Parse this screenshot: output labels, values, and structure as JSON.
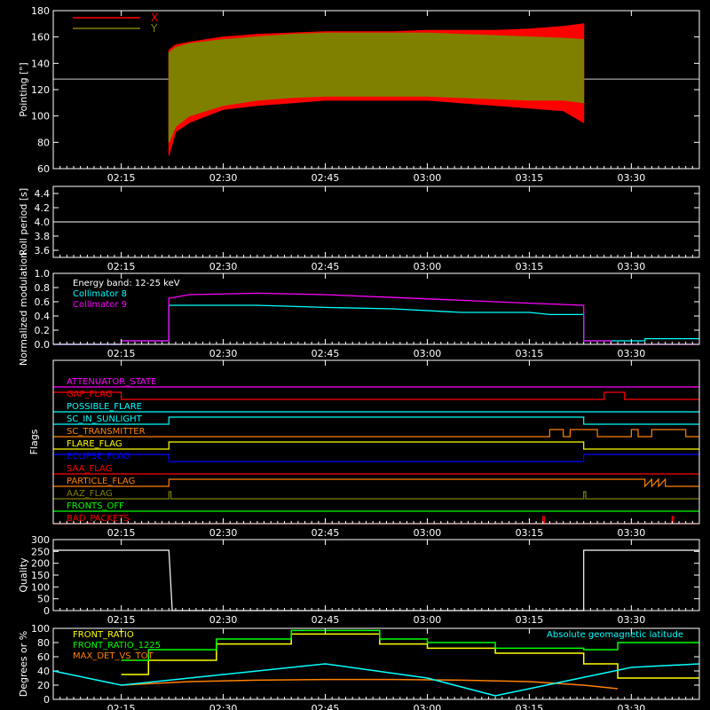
{
  "chart_data": [
    {
      "type": "line",
      "panel": "pointing",
      "ylabel": "Pointing [\"]",
      "ylim": [
        60,
        180
      ],
      "yticks": [
        60,
        80,
        100,
        120,
        140,
        160,
        180
      ],
      "xlim_minutes": [
        0,
        95
      ],
      "xticks": [
        "02:15",
        "02:30",
        "02:45",
        "03:00",
        "03:15",
        "03:30"
      ],
      "xtick_minutes": [
        10,
        25,
        40,
        55,
        70,
        85
      ],
      "reference_line": 128,
      "legend": [
        "X",
        "Y"
      ],
      "series": [
        {
          "name": "X",
          "color": "#ff0000",
          "envelope_minutes": [
            17,
            18,
            20,
            25,
            30,
            35,
            40,
            45,
            50,
            55,
            60,
            65,
            70,
            75,
            78
          ],
          "envelope_upper": [
            150,
            154,
            156,
            160,
            162,
            163,
            164,
            164,
            164,
            165,
            165,
            165,
            166,
            168,
            170
          ],
          "envelope_lower": [
            70,
            88,
            95,
            105,
            108,
            110,
            112,
            112,
            112,
            112,
            110,
            108,
            106,
            104,
            95
          ]
        },
        {
          "name": "Y",
          "color": "#808000",
          "envelope_minutes": [
            17,
            18,
            20,
            25,
            30,
            35,
            40,
            45,
            50,
            55,
            60,
            65,
            70,
            75,
            78
          ],
          "envelope_upper": [
            148,
            152,
            155,
            158,
            160,
            162,
            163,
            163,
            163,
            163,
            162,
            161,
            160,
            159,
            158
          ],
          "envelope_lower": [
            80,
            92,
            100,
            108,
            112,
            114,
            115,
            115,
            115,
            115,
            114,
            113,
            112,
            112,
            110
          ]
        }
      ]
    },
    {
      "type": "line",
      "panel": "roll",
      "ylabel": "Roll period [s]",
      "ylim": [
        3.5,
        4.5
      ],
      "yticks": [
        3.6,
        3.8,
        4.0,
        4.2,
        4.4
      ],
      "xticks": [
        "02:15",
        "02:30",
        "02:45",
        "03:00",
        "03:15",
        "03:30"
      ],
      "series": [
        {
          "name": "",
          "color": "#ffffff",
          "x": [
            0,
            95
          ],
          "values": [
            4.0,
            4.0
          ]
        }
      ]
    },
    {
      "type": "line",
      "panel": "modulation",
      "ylabel": "Normalized modulation",
      "ylim": [
        0,
        1.0
      ],
      "yticks": [
        0.0,
        0.2,
        0.4,
        0.6,
        0.8,
        1.0
      ],
      "xticks": [
        "02:15",
        "02:30",
        "02:45",
        "03:00",
        "03:15",
        "03:30"
      ],
      "annotation": "Energy band: 12-25 keV",
      "series": [
        {
          "name": "Collimator 8",
          "color": "#00ffff",
          "x": [
            0,
            10,
            10,
            17,
            17,
            20,
            30,
            40,
            50,
            60,
            70,
            73,
            73,
            78,
            78,
            87,
            87,
            95
          ],
          "values": [
            0,
            0,
            0.05,
            0.05,
            0.55,
            0.55,
            0.55,
            0.52,
            0.5,
            0.45,
            0.45,
            0.42,
            0.42,
            0.42,
            0.05,
            0.05,
            0.08,
            0.08
          ]
        },
        {
          "name": "Collimator 9",
          "color": "#ff00ff",
          "x": [
            0,
            10,
            10,
            17,
            17,
            20,
            30,
            40,
            50,
            60,
            70,
            78,
            78,
            82,
            82,
            95
          ],
          "values": [
            0,
            0,
            0.05,
            0.05,
            0.65,
            0.7,
            0.72,
            0.7,
            0.66,
            0.62,
            0.58,
            0.55,
            0.05,
            0.05,
            0,
            0
          ]
        }
      ]
    },
    {
      "type": "line",
      "panel": "flags",
      "ylabel": "Flags",
      "xticks": [
        "02:15",
        "02:30",
        "02:45",
        "03:00",
        "03:15",
        "03:30"
      ],
      "series": [
        {
          "name": "ATTENUATOR_STATE",
          "color": "#ff00ff",
          "x": [
            0,
            95
          ],
          "values": [
            0,
            0
          ]
        },
        {
          "name": "GAP_FLAG",
          "color": "#ff0000",
          "x": [
            0,
            10,
            10,
            81,
            81,
            84,
            84,
            95
          ],
          "values": [
            1,
            1,
            0,
            0,
            1,
            1,
            0,
            0
          ]
        },
        {
          "name": "POSSIBLE_FLARE",
          "color": "#00ffff",
          "x": [
            0,
            95
          ],
          "values": [
            0,
            0
          ]
        },
        {
          "name": "SC_IN_SUNLIGHT",
          "color": "#00ffff",
          "x": [
            0,
            17,
            17,
            78,
            78,
            95
          ],
          "values": [
            0,
            0,
            1,
            1,
            0,
            0
          ]
        },
        {
          "name": "SC_TRANSMITTER",
          "color": "#ff8000",
          "x": [
            0,
            73,
            73,
            75,
            75,
            76,
            76,
            80,
            80,
            85,
            85,
            86,
            86,
            88,
            88,
            93,
            93,
            95
          ],
          "values": [
            0,
            0,
            1,
            1,
            0,
            0,
            1,
            1,
            0,
            0,
            1,
            1,
            0,
            0,
            1,
            1,
            0,
            0
          ]
        },
        {
          "name": "FLARE_FLAG",
          "color": "#ffff00",
          "x": [
            0,
            17,
            17,
            78,
            78,
            95
          ],
          "values": [
            0,
            0,
            1,
            1,
            0,
            0
          ]
        },
        {
          "name": "ECLIPSE_FLAG",
          "color": "#0000ff",
          "x": [
            0,
            17,
            17,
            78,
            78,
            95
          ],
          "values": [
            1,
            1,
            0,
            0,
            1,
            1
          ]
        },
        {
          "name": "SAA_FLAG",
          "color": "#ff0000",
          "x": [
            0,
            95
          ],
          "values": [
            0,
            0
          ]
        },
        {
          "name": "PARTICLE_FLAG",
          "color": "#ff8000",
          "x": [
            0,
            17,
            17,
            87,
            87,
            88,
            88,
            89,
            89,
            90,
            90,
            95
          ],
          "values": [
            0,
            0,
            1,
            1,
            0,
            1,
            0,
            1,
            0,
            1,
            0,
            0
          ]
        },
        {
          "name": "AAZ_FLAG",
          "color": "#808000",
          "x": [
            0,
            17,
            17,
            17.3,
            17.3,
            78,
            78,
            78.3,
            78.3,
            95
          ],
          "values": [
            0,
            0,
            1,
            1,
            0,
            0,
            1,
            1,
            0,
            0
          ]
        },
        {
          "name": "FRONTS_OFF",
          "color": "#00ff00",
          "x": [
            0,
            95
          ],
          "values": [
            0,
            0
          ]
        },
        {
          "name": "BAD_PACKETS",
          "color": "#ff0000",
          "x": [
            0,
            72,
            72,
            72.2,
            72.2,
            91,
            91,
            91.2,
            91.2,
            95
          ],
          "values": [
            0,
            0,
            1,
            1,
            0,
            0,
            1,
            1,
            0,
            0
          ]
        }
      ]
    },
    {
      "type": "line",
      "panel": "quality",
      "ylabel": "Quality",
      "ylim": [
        0,
        300
      ],
      "yticks": [
        0,
        50,
        100,
        150,
        200,
        250,
        300
      ],
      "xticks": [
        "02:15",
        "02:30",
        "02:45",
        "03:00",
        "03:15",
        "03:30"
      ],
      "series": [
        {
          "name": "",
          "color": "#ffffff",
          "x": [
            0,
            17,
            17.5,
            78,
            78,
            95
          ],
          "values": [
            255,
            255,
            0,
            0,
            255,
            255
          ]
        }
      ]
    },
    {
      "type": "line",
      "panel": "ratios",
      "ylabel": "Degrees or %",
      "ylim": [
        0,
        100
      ],
      "yticks": [
        0,
        20,
        40,
        60,
        80,
        100
      ],
      "xticks": [
        "02:15",
        "02:30",
        "02:45",
        "03:00",
        "03:15",
        "03:30"
      ],
      "legend_right": "Absolute geomagnetic latitude",
      "series": [
        {
          "name": "FRONT_RATIO",
          "color": "#ffff00",
          "x": [
            10,
            14,
            14,
            24,
            24,
            35,
            35,
            48,
            48,
            55,
            55,
            65,
            65,
            78,
            78,
            83,
            83,
            95
          ],
          "values": [
            35,
            35,
            55,
            55,
            78,
            78,
            92,
            92,
            78,
            78,
            72,
            72,
            65,
            65,
            50,
            50,
            30,
            30
          ]
        },
        {
          "name": "FRONT_RATIO_1225",
          "color": "#00ff00",
          "x": [
            10,
            14,
            14,
            24,
            24,
            35,
            35,
            48,
            48,
            55,
            55,
            65,
            65,
            78,
            78,
            83,
            83,
            95
          ],
          "values": [
            55,
            55,
            70,
            70,
            85,
            85,
            97,
            97,
            85,
            85,
            80,
            80,
            72,
            72,
            70,
            70,
            80,
            80
          ]
        },
        {
          "name": "MAX_DET_VS_TOT",
          "color": "#ff8000",
          "x": [
            10,
            20,
            30,
            40,
            50,
            60,
            70,
            78,
            83
          ],
          "values": [
            20,
            25,
            27,
            28,
            28,
            27,
            25,
            20,
            15
          ]
        },
        {
          "name": "",
          "color": "#00ffff",
          "x": [
            0,
            10,
            25,
            40,
            55,
            65,
            75,
            85,
            95
          ],
          "values": [
            40,
            20,
            35,
            50,
            30,
            5,
            25,
            45,
            50
          ]
        }
      ]
    }
  ]
}
